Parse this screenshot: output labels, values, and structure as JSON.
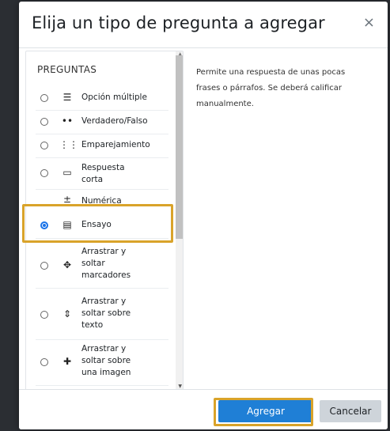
{
  "dialog": {
    "title": "Elija un tipo de pregunta a agregar",
    "close_glyph": "×"
  },
  "list": {
    "heading": "PREGUNTAS",
    "items": [
      {
        "label": "Opción múltiple",
        "icon": "list-icon",
        "glyph": "☰",
        "selected": false
      },
      {
        "label": "Verdadero/Falso",
        "icon": "dots-icon",
        "glyph": "••",
        "selected": false
      },
      {
        "label": "Emparejamiento",
        "icon": "grid-icon",
        "glyph": "⋮⋮",
        "selected": false
      },
      {
        "label": "Respuesta corta",
        "icon": "short-answer-icon",
        "glyph": "▭",
        "selected": false
      },
      {
        "label": "Numérica",
        "icon": "numeric-icon",
        "glyph": "±",
        "selected": false
      },
      {
        "label": "Ensayo",
        "icon": "essay-icon",
        "glyph": "▤",
        "selected": true
      },
      {
        "label": "Arrastrar y soltar marcadores",
        "icon": "drag-markers-icon",
        "glyph": "✥",
        "selected": false
      },
      {
        "label": "Arrastrar y soltar sobre texto",
        "icon": "drag-text-icon",
        "glyph": "⇕",
        "selected": false
      },
      {
        "label": "Arrastrar y soltar sobre una imagen",
        "icon": "drag-image-icon",
        "glyph": "✚",
        "selected": false
      }
    ]
  },
  "description": {
    "text": "Permite una respuesta de unas pocas frases o párrafos. Se deberá calificar manualmente."
  },
  "footer": {
    "add_label": "Agregar",
    "cancel_label": "Cancelar"
  },
  "colors": {
    "primary": "#1f7fd6",
    "highlight": "#d9a32a",
    "secondary": "#ced4da"
  }
}
